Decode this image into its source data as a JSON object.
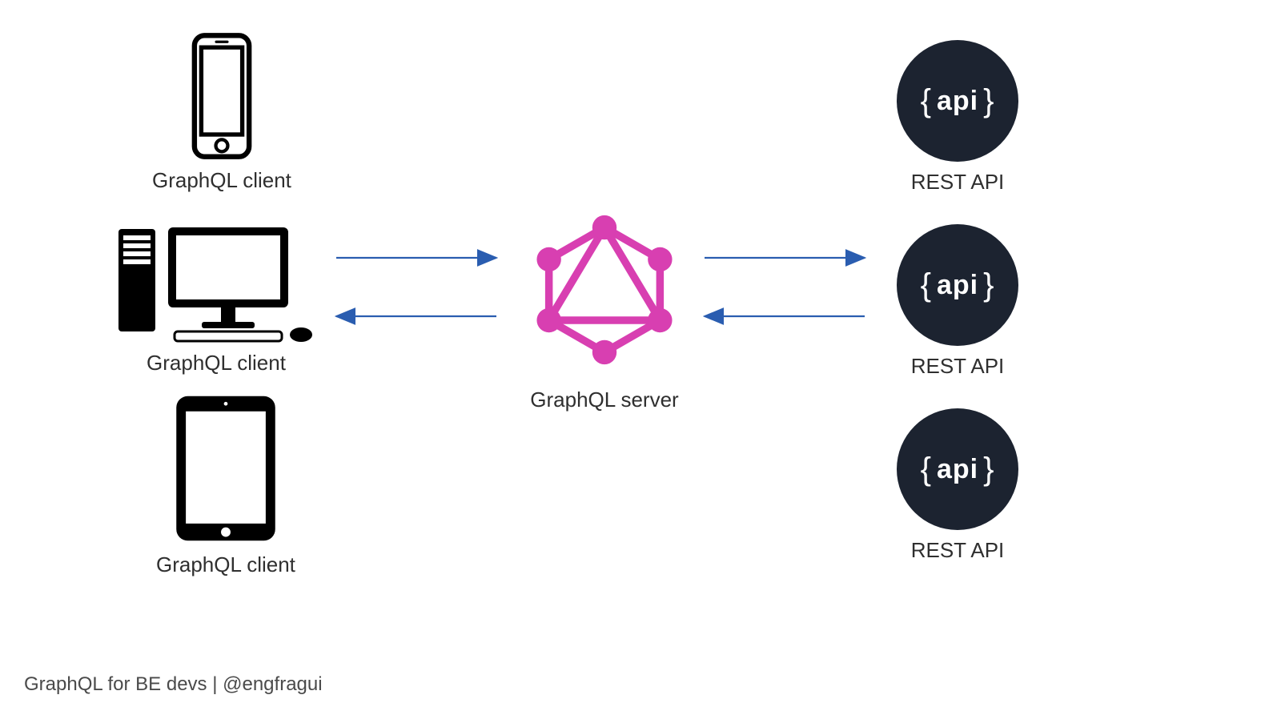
{
  "clients": [
    {
      "label": "GraphQL client",
      "device": "smartphone"
    },
    {
      "label": "GraphQL client",
      "device": "desktop"
    },
    {
      "label": "GraphQL client",
      "device": "tablet"
    }
  ],
  "server": {
    "label": "GraphQL server"
  },
  "apis": [
    {
      "badge": "api",
      "label": "REST API"
    },
    {
      "badge": "api",
      "label": "REST API"
    },
    {
      "badge": "api",
      "label": "REST API"
    }
  ],
  "arrows": {
    "client_to_server": true,
    "server_to_client": true,
    "server_to_api": true,
    "api_to_server": true
  },
  "colors": {
    "graphql": "#d83fb1",
    "arrow": "#2a5db0",
    "api_bg": "#1c2330"
  },
  "footer": "GraphQL for BE devs | @engfragui"
}
